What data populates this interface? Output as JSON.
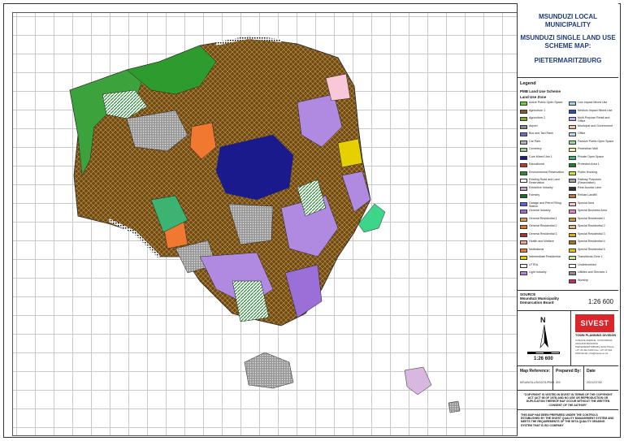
{
  "title": {
    "line1": "MSUNDUZI LOCAL MUNICIPALITY",
    "line2": "MSUNDUZI SINGLE LAND USE SCHEME MAP:",
    "line3": "PIETERMARITZBURG"
  },
  "legend": {
    "heading": "Legend",
    "subheading": "PMB Land Use Scheme",
    "subheading2": "Land Use Zone",
    "col1": [
      {
        "label": "Active Public Open Space",
        "color": "#6fd13f"
      },
      {
        "label": "Agriculture 1",
        "color": "#8a5a2b"
      },
      {
        "label": "Agriculture 2",
        "color": "#7fae2a"
      },
      {
        "label": "Airport",
        "color": "#8c8c8c"
      },
      {
        "label": "Bus and Taxi Rank",
        "color": "#6e6ad6"
      },
      {
        "label": "Car Park",
        "color": "#b4b4b4"
      },
      {
        "label": "Cemetery",
        "color": "#9ad08a"
      },
      {
        "label": "Core Mixed Use 1",
        "color": "#1a1a8c"
      },
      {
        "label": "Educational",
        "color": "#d62b2b"
      },
      {
        "label": "Environmental Reservation",
        "color": "#2e8b3a"
      },
      {
        "label": "Existing Road and Lane Reservation",
        "color": "#ffffff"
      },
      {
        "label": "Extractive Industry",
        "color": "#c8a4c8"
      },
      {
        "label": "Forestry",
        "color": "#1f6e1f"
      },
      {
        "label": "Garage and Petrol Filling Station",
        "color": "#5a5aff"
      },
      {
        "label": "General Industry",
        "color": "#9a6fd8"
      },
      {
        "label": "General Residential 1",
        "color": "#d4a060"
      },
      {
        "label": "General Residential 2",
        "color": "#e07a2a"
      },
      {
        "label": "General Residential 3",
        "color": "#b03030"
      },
      {
        "label": "Health and Welfare",
        "color": "#f0a0a0"
      },
      {
        "label": "Institutional",
        "color": "#f07830"
      },
      {
        "label": "Intermediate Residential",
        "color": "#e6d000"
      },
      {
        "label": "LFTEA",
        "color": "#f0f0f0"
      },
      {
        "label": "Light Industry",
        "color": "#b08ae0"
      }
    ],
    "col2": [
      {
        "label": "Low Impact Mixed Use",
        "color": "#9fd4ef"
      },
      {
        "label": "Medium Impact Mixed Use",
        "color": "#2a4fc0"
      },
      {
        "label": "Multi-Purpose Retail and Office",
        "color": "#b8b0f0"
      },
      {
        "label": "Municipal and Government",
        "color": "#f4c0a0"
      },
      {
        "label": "Office",
        "color": "#c0d8f0"
      },
      {
        "label": "Passive Public Open Space",
        "color": "#8fe08f"
      },
      {
        "label": "Pedestrian Mall",
        "color": "#f0f0a0"
      },
      {
        "label": "Private Open Space",
        "color": "#3cb371"
      },
      {
        "label": "Protected Area 1",
        "color": "#2d7a2d"
      },
      {
        "label": "Public Housing",
        "color": "#d0e040"
      },
      {
        "label": "Railway Purposes (Reservation)",
        "color": "#a0a0a0"
      },
      {
        "label": "Rear Access Lane",
        "color": "#303030"
      },
      {
        "label": "Refuse Landfill",
        "color": "#b87840"
      },
      {
        "label": "Special Area",
        "color": "#f8c8d8"
      },
      {
        "label": "Special Business Area",
        "color": "#f080c0"
      },
      {
        "label": "Special Residential 1",
        "color": "#c89a40"
      },
      {
        "label": "Special Residential 2",
        "color": "#e8b870"
      },
      {
        "label": "Special Residential 3",
        "color": "#d8b020"
      },
      {
        "label": "Special Residential 4",
        "color": "#a07820"
      },
      {
        "label": "Special Residential 5",
        "color": "#f0c000"
      },
      {
        "label": "Transitional Zone 1",
        "color": "#c8e8a0"
      },
      {
        "label": "Undetermined",
        "color": "#ffffff"
      },
      {
        "label": "Utilities and Services 1",
        "color": "#909090"
      },
      {
        "label": "Worship",
        "color": "#c03060"
      }
    ]
  },
  "source": {
    "label": "SOURCE",
    "text": "Msunduzi Municipality Demarcation Board",
    "scale": "1:26 600"
  },
  "north": {
    "letter": "N",
    "scale": "1:26 600"
  },
  "logo": {
    "brand": "SiVEST",
    "division": "TOWN PLANNING DIVISION",
    "address": "4 PEACE AVENUE, CONCORDIA  ANCHOR BUILDING  PIETERMARITZBURG  3201  Phone: +27 33 342 1000  Fax: +27 33 342 1050  Email: info@sivest.co.za"
  },
  "reference": {
    "map_ref_label": "Map Reference:",
    "map_ref_value": "MSUN/SLUS/02/01/PMB",
    "prepared_label": "Prepared By:",
    "prepared_value": "ZM",
    "date_label": "Date",
    "date_value": "2021/07/02"
  },
  "copyright": "\"COPYRIGHT IS VESTED IN SIVEST IN TERMS OF THE COPYRIGHT ACT (ACT 98 OF 1978) AND NO USE OR REPRODUCTION OR DUPLICATION THEREOF MAY OCCUR WITHOUT THE WRITTEN CONSENT OF THE AUTHOR\"",
  "quality": "THIS MAP HAS BEEN PREPARED UNDER THE CONTROLS ESTABLISHED BY THE SIVEST QUALITY MANAGEMENT SYSTEM AND MEETS THE REQUIREMENTS OF THE SETA QUALITY GRADING SYSTEM THAT IS ISO COMPANY"
}
